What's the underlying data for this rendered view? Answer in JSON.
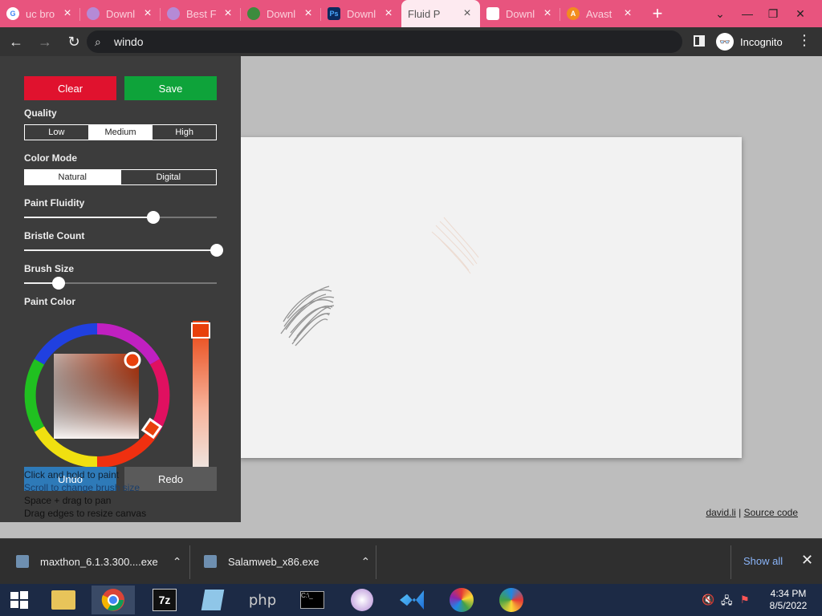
{
  "tabs": [
    {
      "title": "uc bro",
      "fav_color": "#ffffff",
      "fav_glyph": "G"
    },
    {
      "title": "Downl",
      "fav_color": "#b58ad6",
      "fav_glyph": ""
    },
    {
      "title": "Best F",
      "fav_color": "#b58ad6",
      "fav_glyph": ""
    },
    {
      "title": "Downl",
      "fav_color": "#3d8b3d",
      "fav_glyph": ""
    },
    {
      "title": "Downl",
      "fav_color": "#0b2a5e",
      "fav_glyph": "Ps"
    },
    {
      "title": "Fluid P",
      "fav_color": "",
      "fav_glyph": "",
      "active": true
    },
    {
      "title": "Downl",
      "fav_color": "#ffffff",
      "fav_glyph": ""
    },
    {
      "title": "Avast",
      "fav_color": "#f28c1e",
      "fav_glyph": "A"
    }
  ],
  "address": {
    "value": "windo"
  },
  "incognito_label": "Incognito",
  "panel": {
    "clear_label": "Clear",
    "save_label": "Save",
    "quality_label": "Quality",
    "quality_options": [
      "Low",
      "Medium",
      "High"
    ],
    "quality_selected": "Medium",
    "color_mode_label": "Color Mode",
    "color_mode_options": [
      "Natural",
      "Digital"
    ],
    "color_mode_selected": "Natural",
    "fluidity_label": "Paint Fluidity",
    "fluidity_value": 0.67,
    "bristle_label": "Bristle Count",
    "bristle_value": 1.0,
    "brush_label": "Brush Size",
    "brush_value": 0.18,
    "paint_color_label": "Paint Color",
    "paint_color": "#e8400c",
    "undo_label": "Undo",
    "redo_label": "Redo",
    "help": [
      "Click and hold to paint",
      "Scroll to change brush size",
      "Space + drag to pan",
      "Drag edges to resize canvas"
    ]
  },
  "credits": {
    "author": "david.li",
    "separator": "|",
    "source": "Source code"
  },
  "downloads": [
    {
      "name": "maxthon_6.1.3.300....exe"
    },
    {
      "name": "Salamweb_x86.exe"
    }
  ],
  "show_all": "Show all",
  "taskbar": {
    "time": "4:34 PM",
    "date": "8/5/2022"
  },
  "colors": {
    "tabstrip": "#e8547e",
    "clear": "#e0122e",
    "save": "#0ea33a",
    "showall": "#8ab4f8"
  }
}
